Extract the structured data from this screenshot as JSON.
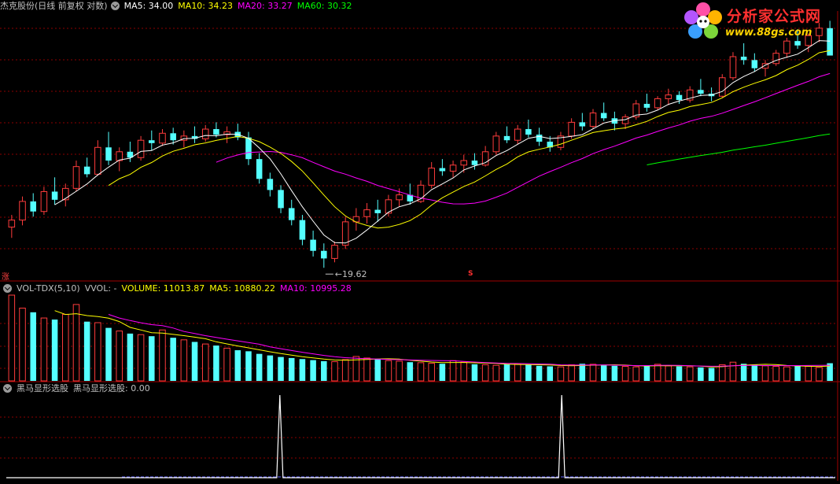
{
  "header": {
    "stock_title": "杰克股份(日线 前复权 对数)",
    "ma5": "MA5: 34.00",
    "ma10": "MA10: 34.23",
    "ma20": "MA20: 33.27",
    "ma60": "MA60: 30.32"
  },
  "volume_header": {
    "title": "VOL-TDX(5,10)",
    "vvol": "VVOL: -",
    "volume": "VOLUME: 11013.87",
    "ma5": "MA5: 10880.22",
    "ma10": "MA10: 10995.28"
  },
  "indicator_header": {
    "title": "黑马显形选股",
    "value": "黑马显形选股: 0.00"
  },
  "annotations": {
    "low_price": "19.62",
    "side_label": "涨",
    "marker": "S"
  },
  "logo": {
    "title": "分析家公式网",
    "url": "www.88gs.com"
  },
  "colors": {
    "up": "#ff3c3c",
    "down": "#54ffff",
    "ma5": "#ffffff",
    "ma10": "#ffff00",
    "ma20": "#ff00ff",
    "ma60": "#00ff00",
    "grid": "#8b0000",
    "signal": "#ffffff"
  },
  "chart_data": {
    "type": "candlestick",
    "price_scale": "log",
    "price_range": [
      19.0,
      38.0
    ],
    "visible_low": 19.62,
    "ohlc": [
      [
        21.8,
        22.5,
        21.2,
        22.2
      ],
      [
        22.2,
        23.6,
        21.9,
        23.3
      ],
      [
        23.3,
        23.8,
        22.4,
        22.7
      ],
      [
        22.7,
        24.2,
        22.5,
        23.9
      ],
      [
        23.9,
        24.8,
        23.1,
        23.4
      ],
      [
        23.4,
        24.4,
        23.0,
        24.1
      ],
      [
        24.1,
        25.9,
        23.9,
        25.5
      ],
      [
        25.5,
        26.1,
        24.8,
        25.0
      ],
      [
        25.0,
        27.3,
        24.9,
        26.8
      ],
      [
        26.8,
        27.9,
        25.6,
        25.9
      ],
      [
        25.9,
        26.8,
        25.2,
        26.5
      ],
      [
        26.5,
        27.2,
        25.8,
        26.1
      ],
      [
        26.1,
        27.6,
        25.9,
        27.3
      ],
      [
        27.3,
        28.0,
        26.6,
        27.1
      ],
      [
        27.1,
        28.1,
        26.9,
        27.8
      ],
      [
        27.8,
        28.2,
        27.0,
        27.3
      ],
      [
        27.3,
        28.0,
        26.8,
        27.6
      ],
      [
        27.6,
        28.3,
        27.1,
        27.4
      ],
      [
        27.4,
        28.4,
        27.2,
        28.1
      ],
      [
        28.1,
        28.6,
        27.5,
        27.7
      ],
      [
        27.7,
        28.3,
        27.1,
        27.9
      ],
      [
        27.9,
        28.5,
        27.3,
        27.5
      ],
      [
        27.5,
        27.9,
        25.6,
        26.0
      ],
      [
        26.0,
        26.4,
        24.4,
        24.7
      ],
      [
        24.7,
        25.1,
        23.6,
        24.0
      ],
      [
        24.0,
        24.3,
        22.6,
        22.9
      ],
      [
        22.9,
        23.4,
        21.9,
        22.2
      ],
      [
        22.2,
        22.5,
        20.8,
        21.1
      ],
      [
        21.1,
        21.6,
        20.2,
        20.5
      ],
      [
        20.5,
        20.9,
        19.62,
        20.1
      ],
      [
        20.1,
        21.0,
        19.9,
        20.8
      ],
      [
        20.8,
        22.4,
        20.6,
        22.1
      ],
      [
        22.1,
        22.9,
        21.6,
        22.4
      ],
      [
        22.4,
        23.2,
        22.0,
        22.8
      ],
      [
        22.8,
        23.4,
        22.1,
        22.6
      ],
      [
        22.6,
        23.7,
        22.4,
        23.4
      ],
      [
        23.4,
        24.1,
        23.0,
        23.7
      ],
      [
        23.7,
        24.4,
        23.1,
        23.3
      ],
      [
        23.3,
        24.6,
        23.2,
        24.3
      ],
      [
        24.3,
        25.8,
        24.1,
        25.4
      ],
      [
        25.4,
        26.0,
        24.9,
        25.2
      ],
      [
        25.2,
        25.9,
        24.8,
        25.6
      ],
      [
        25.6,
        26.3,
        25.1,
        25.9
      ],
      [
        25.9,
        26.4,
        25.3,
        25.6
      ],
      [
        25.6,
        26.9,
        25.5,
        26.5
      ],
      [
        26.5,
        27.9,
        26.3,
        27.6
      ],
      [
        27.6,
        28.3,
        27.1,
        27.3
      ],
      [
        27.3,
        28.4,
        27.0,
        28.1
      ],
      [
        28.1,
        28.8,
        27.5,
        27.7
      ],
      [
        27.7,
        28.2,
        26.9,
        27.2
      ],
      [
        27.2,
        27.6,
        26.5,
        26.8
      ],
      [
        26.8,
        27.9,
        26.6,
        27.6
      ],
      [
        27.6,
        28.9,
        27.4,
        28.6
      ],
      [
        28.6,
        29.3,
        28.0,
        28.3
      ],
      [
        28.3,
        29.6,
        28.1,
        29.3
      ],
      [
        29.3,
        30.1,
        28.7,
        28.9
      ],
      [
        28.9,
        29.4,
        28.0,
        28.5
      ],
      [
        28.5,
        29.2,
        28.1,
        29.0
      ],
      [
        29.0,
        30.3,
        28.8,
        30.0
      ],
      [
        30.0,
        30.8,
        29.4,
        29.7
      ],
      [
        29.7,
        30.6,
        29.5,
        30.4
      ],
      [
        30.4,
        31.2,
        29.9,
        30.7
      ],
      [
        30.7,
        31.0,
        30.0,
        30.3
      ],
      [
        30.3,
        31.4,
        30.1,
        31.1
      ],
      [
        31.1,
        32.0,
        30.6,
        30.8
      ],
      [
        30.8,
        31.3,
        30.2,
        30.6
      ],
      [
        30.6,
        32.4,
        30.5,
        32.1
      ],
      [
        32.1,
        34.3,
        31.9,
        33.9
      ],
      [
        33.9,
        35.1,
        33.2,
        33.6
      ],
      [
        33.6,
        34.2,
        32.6,
        32.9
      ],
      [
        32.9,
        33.6,
        32.2,
        33.3
      ],
      [
        33.3,
        34.5,
        33.1,
        34.2
      ],
      [
        34.2,
        35.6,
        33.8,
        35.3
      ],
      [
        35.3,
        36.4,
        34.6,
        34.9
      ],
      [
        34.9,
        36.0,
        34.3,
        35.8
      ],
      [
        35.8,
        37.0,
        35.2,
        36.5
      ],
      [
        36.5,
        37.2,
        34.3,
        34.0
      ]
    ],
    "volume": [
      16500,
      14000,
      13200,
      12100,
      11800,
      12800,
      14700,
      11400,
      11200,
      10200,
      9600,
      9100,
      8900,
      8600,
      9800,
      8300,
      7900,
      7500,
      7100,
      6800,
      6300,
      5900,
      5700,
      5200,
      4900,
      4600,
      4400,
      4200,
      4000,
      3800,
      3700,
      4100,
      4700,
      4400,
      4200,
      3900,
      3800,
      3600,
      3500,
      3400,
      3300,
      3900,
      3600,
      3200,
      3100,
      3000,
      3200,
      3300,
      3100,
      2900,
      2800,
      2700,
      3100,
      3300,
      3200,
      3000,
      2900,
      2800,
      2700,
      3000,
      3200,
      2900,
      2800,
      2700,
      2600,
      2500,
      3100,
      3600,
      3300,
      3100,
      2900,
      2800,
      2700,
      2900,
      2800,
      2600,
      3400
    ],
    "signal_peaks": [
      0.33,
      0.67
    ],
    "signal_max": 1.0
  }
}
